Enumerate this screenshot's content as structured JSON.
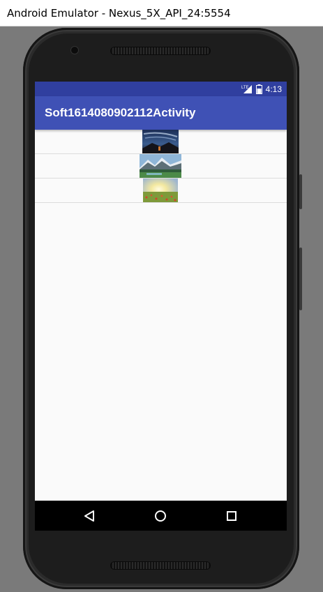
{
  "window": {
    "title": "Android Emulator - Nexus_5X_API_24:5554"
  },
  "statusbar": {
    "time": "4:13",
    "network_label": "LTE"
  },
  "appbar": {
    "title": "Soft1614080902112Activity"
  },
  "list": {
    "items": [
      {
        "image": "night-sky-landscape"
      },
      {
        "image": "mountain-lake-landscape"
      },
      {
        "image": "sunny-flower-field"
      }
    ]
  },
  "navbar": {
    "buttons": [
      "back",
      "home",
      "recents"
    ]
  },
  "colors": {
    "statusbar": "#303f9f",
    "appbar": "#3f51b5",
    "background": "#fafafa",
    "navbar": "#000000"
  }
}
